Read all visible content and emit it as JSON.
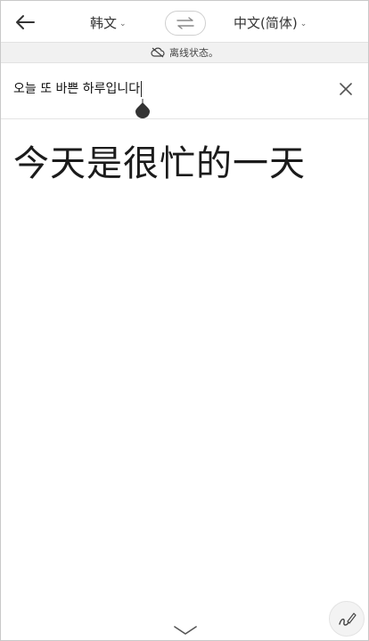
{
  "header": {
    "source_language": "韩文",
    "target_language": "中文(简体)",
    "back_icon": "arrow-left-icon",
    "swap_icon": "swap-arrows-icon",
    "chevron_icon": "chevron-down-icon"
  },
  "status": {
    "offline_text": "离线状态。",
    "icon": "cloud-off-icon"
  },
  "input": {
    "source_text": "오늘 또 바쁜 하루입니다",
    "clear_icon": "close-icon"
  },
  "output": {
    "translation": "今天是很忙的一天"
  },
  "footer": {
    "collapse_icon": "chevron-down-icon",
    "handwriting_icon": "handwriting-pen-icon"
  }
}
